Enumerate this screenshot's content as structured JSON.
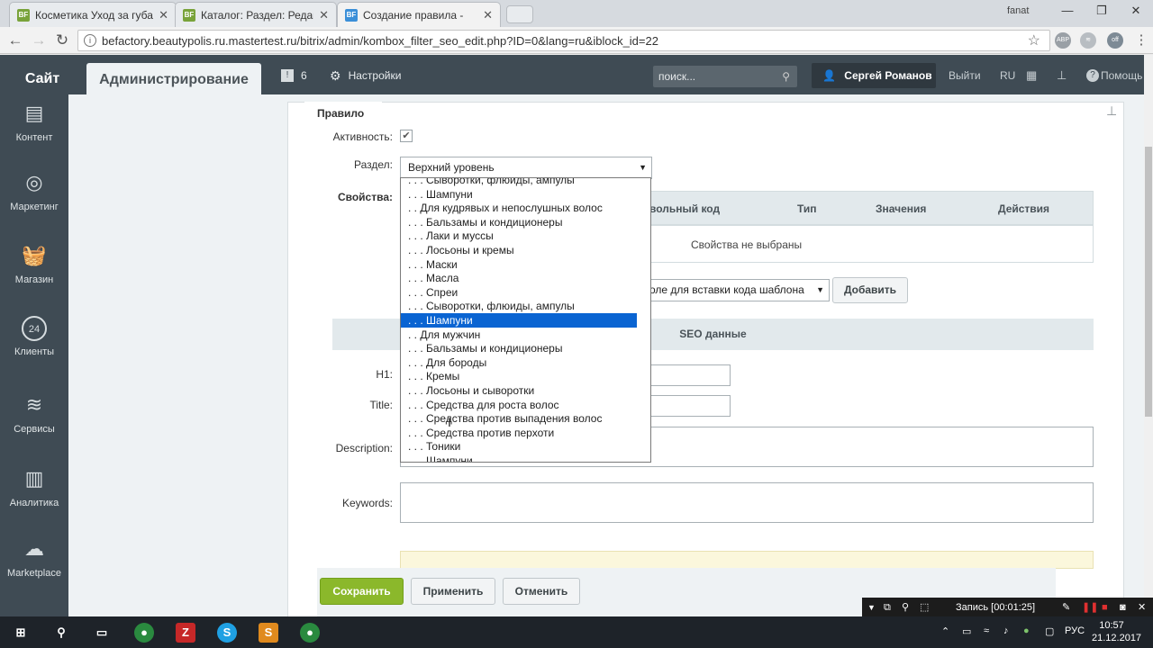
{
  "browser": {
    "tabs": [
      {
        "favicon": "BF",
        "title": "Косметика Уход за губа"
      },
      {
        "favicon": "BF",
        "title": "Каталог: Раздел: Редакт"
      },
      {
        "favicon": "BF",
        "title": "Создание правила -"
      }
    ],
    "username": "fanat",
    "url": "befactory.beautypolis.ru.mastertest.ru/bitrix/admin/kombox_filter_seo_edit.php?ID=0&lang=ru&iblock_id=22"
  },
  "panel": {
    "site": "Сайт",
    "admin": "Администрирование",
    "notifications": "6",
    "settings": "Настройки",
    "search_placeholder": "поиск...",
    "user": "Сергей Романов",
    "logout": "Выйти",
    "lang": "RU",
    "help": "Помощь"
  },
  "sidebar": {
    "items": [
      {
        "label": "Контент",
        "icon": "document-icon"
      },
      {
        "label": "Маркетинг",
        "icon": "target-icon"
      },
      {
        "label": "Магазин",
        "icon": "basket-icon"
      },
      {
        "label": "Клиенты",
        "icon": "clients-icon"
      },
      {
        "label": "Сервисы",
        "icon": "layers-icon"
      },
      {
        "label": "Аналитика",
        "icon": "chart-icon"
      },
      {
        "label": "Marketplace",
        "icon": "cloud-download-icon"
      }
    ]
  },
  "form": {
    "tab": "Правило",
    "active_label": "Активность:",
    "section_label": "Раздел:",
    "section_value": "Верхний уровень",
    "props_label": "Свойства:",
    "props_columns": [
      "вольный код",
      "Тип",
      "Значения",
      "Действия"
    ],
    "props_empty": "Свойства не выбраны",
    "field_select": "оле для вставки кода шаблона",
    "add_button": "Добавить",
    "seo_header": "SEO данные",
    "h1_label": "H1:",
    "title_label": "Title:",
    "description_label": "Description:",
    "keywords_label": "Keywords:"
  },
  "dropdown": {
    "items": [
      ". . . Сыворотки, флюиды, ампулы",
      ". . . Шампуни",
      ". . Для кудрявых и непослушных волос",
      ". . . Бальзамы и кондиционеры",
      ". . . Лаки и муссы",
      ". . . Лосьоны и кремы",
      ". . . Маски",
      ". . . Масла",
      ". . . Спреи",
      ". . . Сыворотки, флюиды, ампулы",
      ". . . Шампуни",
      ". . Для мужчин",
      ". . . Бальзамы и кондиционеры",
      ". . . Для бороды",
      ". . . Кремы",
      ". . . Лосьоны и сыворотки",
      ". . . Средства для роста волос",
      ". . . Средства против выпадения волос",
      ". . . Средства против перхоти",
      ". . . Тоники",
      ". . . Шампуни"
    ],
    "selected_index": 10
  },
  "buttons": {
    "save": "Сохранить",
    "apply": "Применить",
    "cancel": "Отменить"
  },
  "recorder": {
    "status": "Запись [00:01:25]"
  },
  "taskbar": {
    "lang": "РУС",
    "time": "10:57",
    "date": "21.12.2017"
  }
}
